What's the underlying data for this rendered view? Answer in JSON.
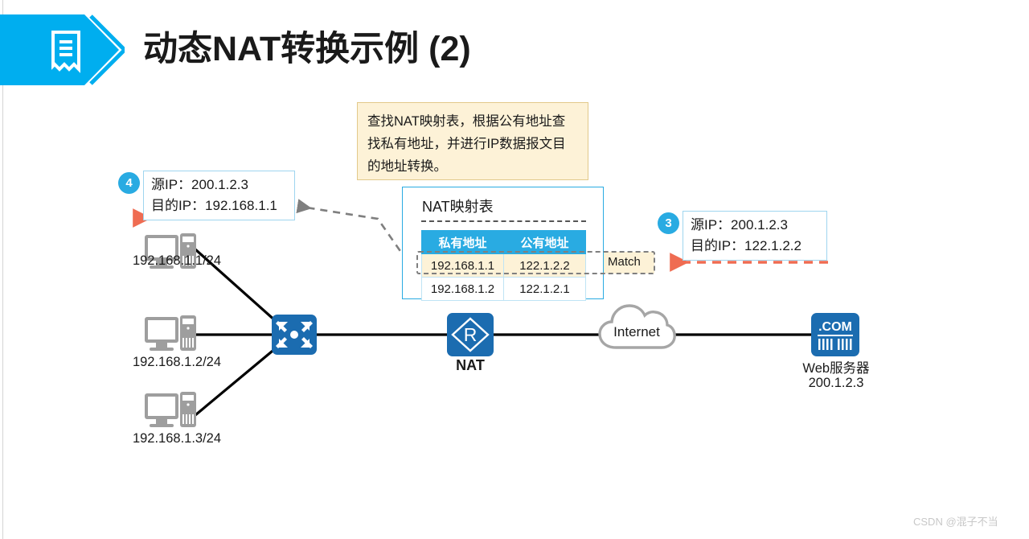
{
  "header": {
    "title": "动态NAT转换示例 (2)",
    "banner_icon": "document-bookmark-icon",
    "banner_color": "#00aeef"
  },
  "callout": {
    "text": "查找NAT映射表，根据公有地址查找私有地址，并进行IP数据报文目的地址转换。",
    "bg_color": "#fdf2d7",
    "border_color": "#e2c98b"
  },
  "packets": {
    "left": {
      "badge": "4",
      "src_line": "源IP：200.1.2.3",
      "dst_line": "目的IP：192.168.1.1"
    },
    "right": {
      "badge": "3",
      "src_line": "源IP：200.1.2.3",
      "dst_line": "目的IP：122.1.2.2"
    }
  },
  "nat_table": {
    "title": "NAT映射表",
    "columns": [
      "私有地址",
      "公有地址"
    ],
    "rows": [
      {
        "private": "192.168.1.1",
        "public": "122.1.2.2",
        "matched": true
      },
      {
        "private": "192.168.1.2",
        "public": "122.1.2.1",
        "matched": false
      }
    ],
    "match_label": "Match",
    "header_color": "#29abe2",
    "match_row_color": "#fdf2d7"
  },
  "topology": {
    "pcs": [
      {
        "label": "192.168.1.1/24"
      },
      {
        "label": "192.168.1.2/24"
      },
      {
        "label": "192.168.1.3/24"
      }
    ],
    "switch": {
      "icon": "switch-icon",
      "color": "#1b6cb0"
    },
    "router": {
      "icon": "router-r-icon",
      "label": "NAT",
      "color": "#1b6cb0"
    },
    "cloud": {
      "icon": "cloud-icon",
      "label": "Internet"
    },
    "server": {
      "icon": "web-server-com-icon",
      "badge_text": ".COM",
      "label": "Web服务器",
      "ip": "200.1.2.3",
      "color": "#1b6cb0"
    }
  },
  "arrows": {
    "flow_color": "#ef6c52",
    "pointer_color": "#7f7f7f"
  },
  "watermark": {
    "text": "CSDN @混子不当"
  }
}
